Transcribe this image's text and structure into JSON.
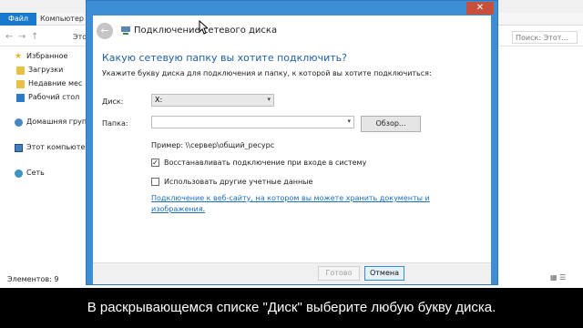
{
  "explorer": {
    "tabs": {
      "file": "Файл",
      "computer": "Компьютер"
    },
    "address": "Этот",
    "search_placeholder": "Поиск: Этот...",
    "nav": [
      {
        "label": "Избранное",
        "icon": "star-icon"
      },
      {
        "label": "Загрузки",
        "icon": "folder-icon"
      },
      {
        "label": "Недавние мес",
        "icon": "folder-icon"
      },
      {
        "label": "Рабочий стол",
        "icon": "desktop-icon"
      },
      {
        "label": "Домашняя груп",
        "icon": "homegroup-icon"
      },
      {
        "label": "Этот компьюте",
        "icon": "computer-icon"
      },
      {
        "label": "Сеть",
        "icon": "network-icon"
      }
    ],
    "status": "Элементов: 9"
  },
  "dialog": {
    "title": "Подключение сетевого диска",
    "close": "✕",
    "heading": "Какую сетевую папку вы хотите подключить?",
    "subheading": "Укажите букву диска для подключения и папку, к которой вы хотите подключиться:",
    "drive_label": "Диск:",
    "drive_value": "X:",
    "folder_label": "Папка:",
    "folder_value": "",
    "browse": "Обзор...",
    "example": "Пример: \\\\сервер\\общий_ресурс",
    "reconnect_label": "Восстанавливать подключение при входе в систему",
    "reconnect_checked": true,
    "credentials_label": "Использовать другие учетные данные",
    "credentials_checked": false,
    "link_text": "Подключение к веб-сайту, на котором вы можете хранить документы и изображения",
    "link_tail": ".",
    "ok": "Готово",
    "cancel": "Отмена"
  },
  "caption": "В раскрывающемся списке \"Диск\" выберите любую букву диска.",
  "colors": {
    "accent": "#3e8ed6",
    "link": "#1d6fbe",
    "heading": "#1f5fa7",
    "close": "#c7503d"
  }
}
